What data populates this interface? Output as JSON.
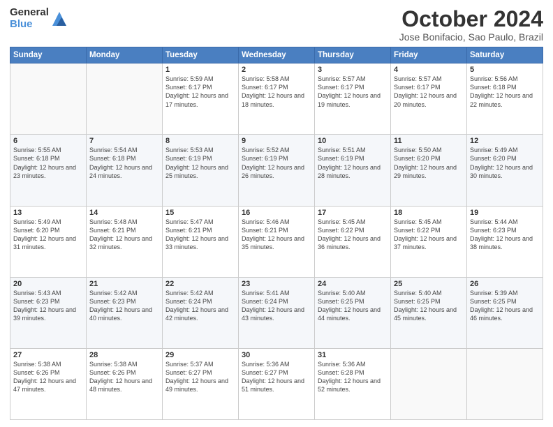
{
  "header": {
    "logo_general": "General",
    "logo_blue": "Blue",
    "title": "October 2024",
    "location": "Jose Bonifacio, Sao Paulo, Brazil"
  },
  "days_of_week": [
    "Sunday",
    "Monday",
    "Tuesday",
    "Wednesday",
    "Thursday",
    "Friday",
    "Saturday"
  ],
  "weeks": [
    [
      {
        "day": "",
        "info": ""
      },
      {
        "day": "",
        "info": ""
      },
      {
        "day": "1",
        "info": "Sunrise: 5:59 AM\nSunset: 6:17 PM\nDaylight: 12 hours and 17 minutes."
      },
      {
        "day": "2",
        "info": "Sunrise: 5:58 AM\nSunset: 6:17 PM\nDaylight: 12 hours and 18 minutes."
      },
      {
        "day": "3",
        "info": "Sunrise: 5:57 AM\nSunset: 6:17 PM\nDaylight: 12 hours and 19 minutes."
      },
      {
        "day": "4",
        "info": "Sunrise: 5:57 AM\nSunset: 6:17 PM\nDaylight: 12 hours and 20 minutes."
      },
      {
        "day": "5",
        "info": "Sunrise: 5:56 AM\nSunset: 6:18 PM\nDaylight: 12 hours and 22 minutes."
      }
    ],
    [
      {
        "day": "6",
        "info": "Sunrise: 5:55 AM\nSunset: 6:18 PM\nDaylight: 12 hours and 23 minutes."
      },
      {
        "day": "7",
        "info": "Sunrise: 5:54 AM\nSunset: 6:18 PM\nDaylight: 12 hours and 24 minutes."
      },
      {
        "day": "8",
        "info": "Sunrise: 5:53 AM\nSunset: 6:19 PM\nDaylight: 12 hours and 25 minutes."
      },
      {
        "day": "9",
        "info": "Sunrise: 5:52 AM\nSunset: 6:19 PM\nDaylight: 12 hours and 26 minutes."
      },
      {
        "day": "10",
        "info": "Sunrise: 5:51 AM\nSunset: 6:19 PM\nDaylight: 12 hours and 28 minutes."
      },
      {
        "day": "11",
        "info": "Sunrise: 5:50 AM\nSunset: 6:20 PM\nDaylight: 12 hours and 29 minutes."
      },
      {
        "day": "12",
        "info": "Sunrise: 5:49 AM\nSunset: 6:20 PM\nDaylight: 12 hours and 30 minutes."
      }
    ],
    [
      {
        "day": "13",
        "info": "Sunrise: 5:49 AM\nSunset: 6:20 PM\nDaylight: 12 hours and 31 minutes."
      },
      {
        "day": "14",
        "info": "Sunrise: 5:48 AM\nSunset: 6:21 PM\nDaylight: 12 hours and 32 minutes."
      },
      {
        "day": "15",
        "info": "Sunrise: 5:47 AM\nSunset: 6:21 PM\nDaylight: 12 hours and 33 minutes."
      },
      {
        "day": "16",
        "info": "Sunrise: 5:46 AM\nSunset: 6:21 PM\nDaylight: 12 hours and 35 minutes."
      },
      {
        "day": "17",
        "info": "Sunrise: 5:45 AM\nSunset: 6:22 PM\nDaylight: 12 hours and 36 minutes."
      },
      {
        "day": "18",
        "info": "Sunrise: 5:45 AM\nSunset: 6:22 PM\nDaylight: 12 hours and 37 minutes."
      },
      {
        "day": "19",
        "info": "Sunrise: 5:44 AM\nSunset: 6:23 PM\nDaylight: 12 hours and 38 minutes."
      }
    ],
    [
      {
        "day": "20",
        "info": "Sunrise: 5:43 AM\nSunset: 6:23 PM\nDaylight: 12 hours and 39 minutes."
      },
      {
        "day": "21",
        "info": "Sunrise: 5:42 AM\nSunset: 6:23 PM\nDaylight: 12 hours and 40 minutes."
      },
      {
        "day": "22",
        "info": "Sunrise: 5:42 AM\nSunset: 6:24 PM\nDaylight: 12 hours and 42 minutes."
      },
      {
        "day": "23",
        "info": "Sunrise: 5:41 AM\nSunset: 6:24 PM\nDaylight: 12 hours and 43 minutes."
      },
      {
        "day": "24",
        "info": "Sunrise: 5:40 AM\nSunset: 6:25 PM\nDaylight: 12 hours and 44 minutes."
      },
      {
        "day": "25",
        "info": "Sunrise: 5:40 AM\nSunset: 6:25 PM\nDaylight: 12 hours and 45 minutes."
      },
      {
        "day": "26",
        "info": "Sunrise: 5:39 AM\nSunset: 6:25 PM\nDaylight: 12 hours and 46 minutes."
      }
    ],
    [
      {
        "day": "27",
        "info": "Sunrise: 5:38 AM\nSunset: 6:26 PM\nDaylight: 12 hours and 47 minutes."
      },
      {
        "day": "28",
        "info": "Sunrise: 5:38 AM\nSunset: 6:26 PM\nDaylight: 12 hours and 48 minutes."
      },
      {
        "day": "29",
        "info": "Sunrise: 5:37 AM\nSunset: 6:27 PM\nDaylight: 12 hours and 49 minutes."
      },
      {
        "day": "30",
        "info": "Sunrise: 5:36 AM\nSunset: 6:27 PM\nDaylight: 12 hours and 51 minutes."
      },
      {
        "day": "31",
        "info": "Sunrise: 5:36 AM\nSunset: 6:28 PM\nDaylight: 12 hours and 52 minutes."
      },
      {
        "day": "",
        "info": ""
      },
      {
        "day": "",
        "info": ""
      }
    ]
  ]
}
